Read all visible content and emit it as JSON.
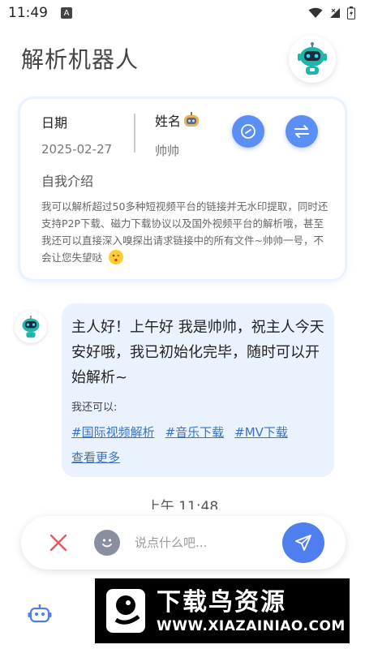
{
  "status": {
    "time": "11:49",
    "notification_icon": "a-square-icon"
  },
  "header": {
    "title": "解析机器人"
  },
  "info_card": {
    "date_label": "日期",
    "date_value": "2025-02-27",
    "name_label": "姓名",
    "name_value": "帅帅",
    "intro_label": "自我介绍",
    "intro_text": "我可以解析超过50多种短视频平台的链接并无水印提取，同时还支持P2P下载、磁力下载协议以及国外视频平台的解析哦，甚至我还可以直接深入嗅探出请求链接中的所有文件~帅帅一号，不会让您失望哒"
  },
  "chat": {
    "greeting": "主人好！上午好 我是帅帅，祝主人今天安好哦，我已初始化完毕，随时可以开始解析~",
    "sub": "我还可以:",
    "links": [
      "#国际视频解析",
      "#音乐下载",
      "#MV下载"
    ],
    "more": "查看更多",
    "timestamp": "上午 11:48"
  },
  "input": {
    "placeholder": "说点什么吧..."
  },
  "watermark": {
    "title": "下载鸟资源",
    "url": "WWW.XIAZAINIAO.COM"
  },
  "colors": {
    "accent": "#5b8ff5",
    "bubble": "#eaf2fe",
    "link": "#3a72c9",
    "clear": "#e05a5a"
  }
}
